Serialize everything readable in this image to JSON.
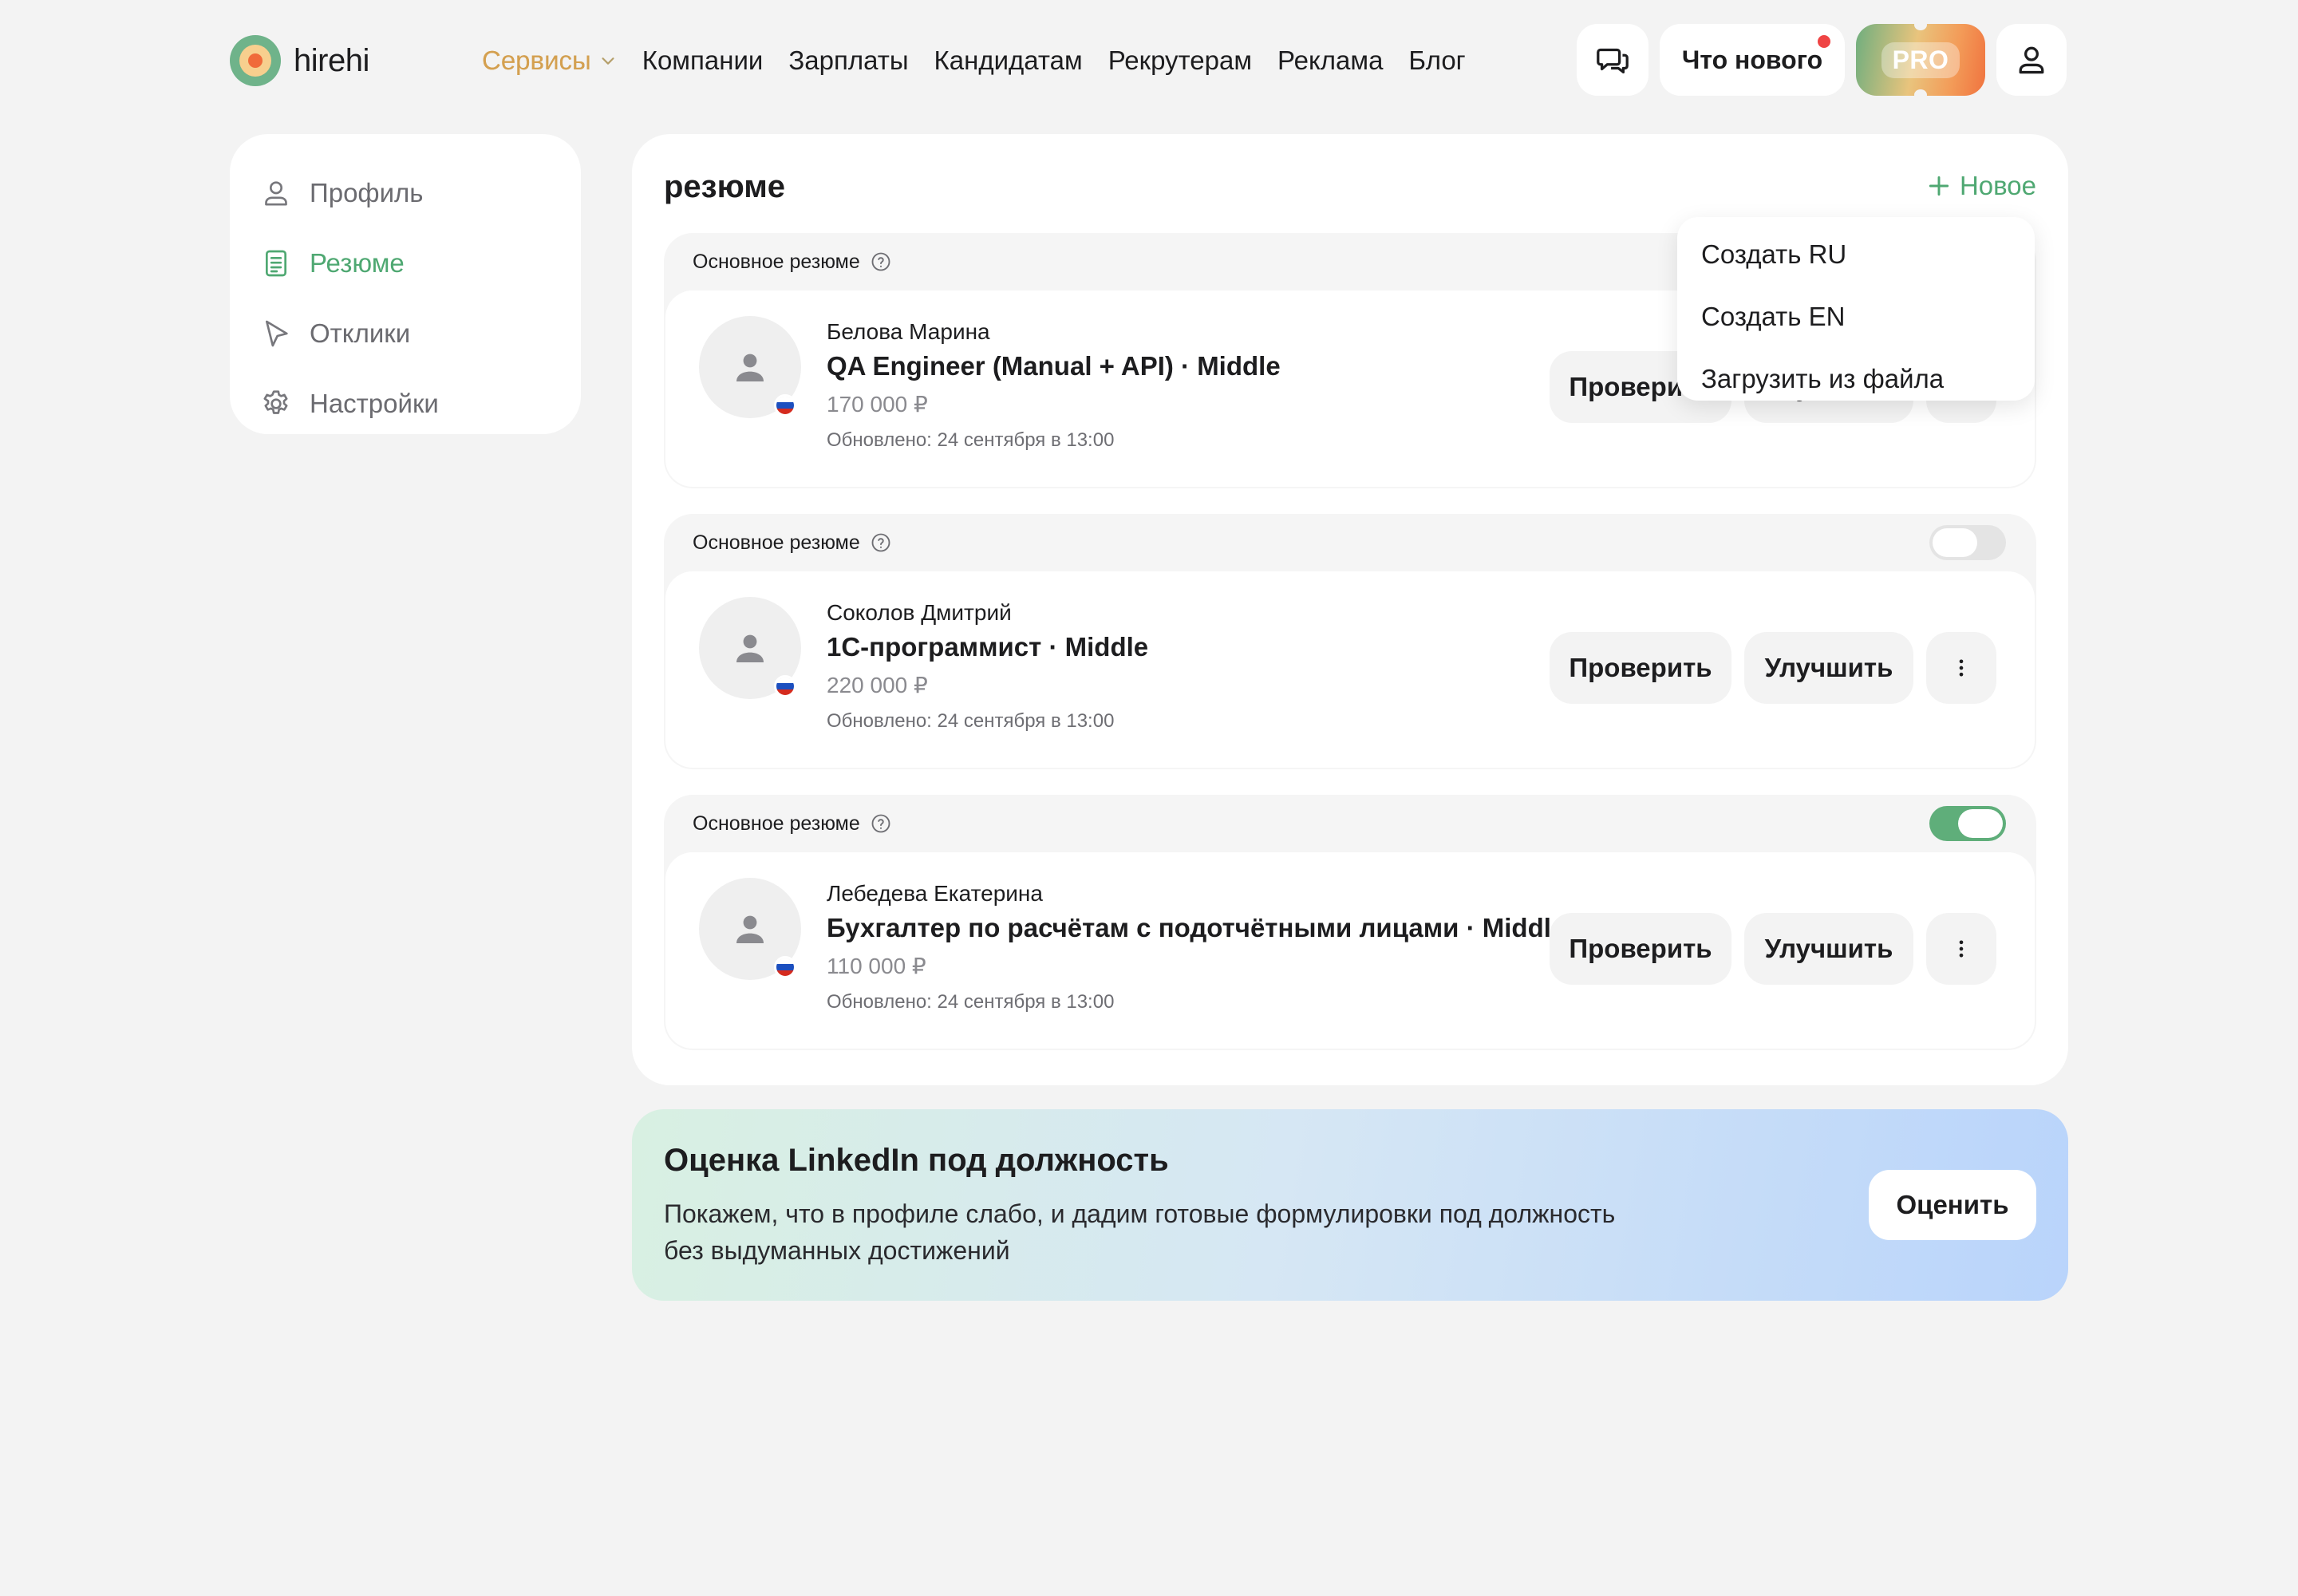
{
  "header": {
    "logo_text": "hirehi",
    "nav": {
      "services": "Сервисы",
      "companies": "Компании",
      "salaries": "Зарплаты",
      "candidates": "Кандидатам",
      "recruiters": "Рекрутерам",
      "ads": "Реклама",
      "blog": "Блог"
    },
    "whats_new": "Что нового",
    "pro": "PRO"
  },
  "sidebar": {
    "items": [
      {
        "label": "Профиль",
        "icon": "user-icon"
      },
      {
        "label": "Резюме",
        "icon": "document-icon",
        "active": true
      },
      {
        "label": "Отклики",
        "icon": "send-icon"
      },
      {
        "label": "Настройки",
        "icon": "gear-icon"
      }
    ]
  },
  "main": {
    "title": "резюме",
    "new_label": "Новое",
    "dropdown": [
      "Создать RU",
      "Создать EN",
      "Загрузить из файла"
    ],
    "check_label": "Проверить",
    "improve_label": "Улучшить",
    "resumes": [
      {
        "head": "Основное резюме",
        "name": "Белова Марина",
        "title": "QA Engineer (Manual + API) · Middle",
        "salary": "170 000 ₽",
        "updated": "Обновлено: 24 сентября в 13:00",
        "primary_toggle_on": null
      },
      {
        "head": "Основное резюме",
        "name": "Соколов Дмитрий",
        "title": "1С-программист · Middle",
        "salary": "220 000 ₽",
        "updated": "Обновлено: 24 сентября в 13:00",
        "primary_toggle_on": false
      },
      {
        "head": "Основное резюме",
        "name": "Лебедева Екатерина",
        "title": "Бухгалтер по расчётам с подотчётными лицами · Middle",
        "salary": "110 000 ₽",
        "updated": "Обновлено: 24 сентября в 13:00",
        "primary_toggle_on": true
      }
    ]
  },
  "banner": {
    "title": "Оценка LinkedIn под должность",
    "text": "Покажем, что в профиле слабо, и дадим готовые формулировки под должность без выдуманных достижений",
    "button": "Оценить"
  },
  "colors": {
    "accent_green": "#4fa872",
    "toggle_on": "#5fae7a",
    "notification_dot": "#ef4444",
    "background": "#f3f3f3"
  }
}
